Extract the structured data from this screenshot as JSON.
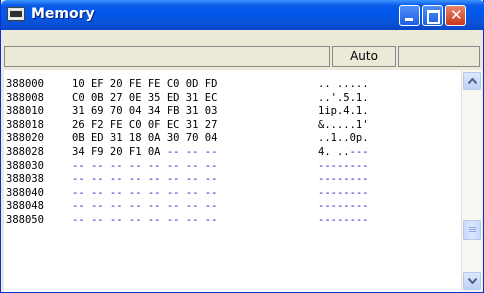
{
  "window": {
    "title": "Memory"
  },
  "toolbar": {
    "address_value": "",
    "auto_label": "Auto"
  },
  "memory_rows": [
    {
      "addr": "388000",
      "bytes": "10 EF 20 FE FE C0 0D FD",
      "ascii": ".. .....",
      "dim": false
    },
    {
      "addr": "388008",
      "bytes": "C0 0B 27 0E 35 ED 31 EC",
      "ascii": "..'.5.1.",
      "dim": false
    },
    {
      "addr": "388010",
      "bytes": "31 69 70 04 34 FB 31 03",
      "ascii": "1ip.4.1.",
      "dim": false
    },
    {
      "addr": "388018",
      "bytes": "26 F2 FE C0 0F EC 31 27",
      "ascii": "&.....1'",
      "dim": false
    },
    {
      "addr": "388020",
      "bytes": "0B ED 31 18 0A 30 70 04",
      "ascii": "..1..0p.",
      "dim": false
    },
    {
      "addr": "388028",
      "bytes": "34 F9 20 F1 0A -- -- --",
      "ascii": "4. ..---",
      "dim": "partial"
    },
    {
      "addr": "388030",
      "bytes": "-- -- -- -- -- -- -- --",
      "ascii": "--------",
      "dim": true
    },
    {
      "addr": "388038",
      "bytes": "-- -- -- -- -- -- -- --",
      "ascii": "--------",
      "dim": true
    },
    {
      "addr": "388040",
      "bytes": "-- -- -- -- -- -- -- --",
      "ascii": "--------",
      "dim": true
    },
    {
      "addr": "388048",
      "bytes": "-- -- -- -- -- -- -- --",
      "ascii": "--------",
      "dim": true
    },
    {
      "addr": "388050",
      "bytes": "-- -- -- -- -- -- -- --",
      "ascii": "--------",
      "dim": true
    }
  ],
  "colors": {
    "titlebar": "#0058EE",
    "unknown_bytes": "#1010C0"
  },
  "icons": [
    "app-icon",
    "minimize-icon",
    "maximize-icon",
    "close-icon",
    "scroll-up-icon",
    "scroll-down-icon"
  ]
}
